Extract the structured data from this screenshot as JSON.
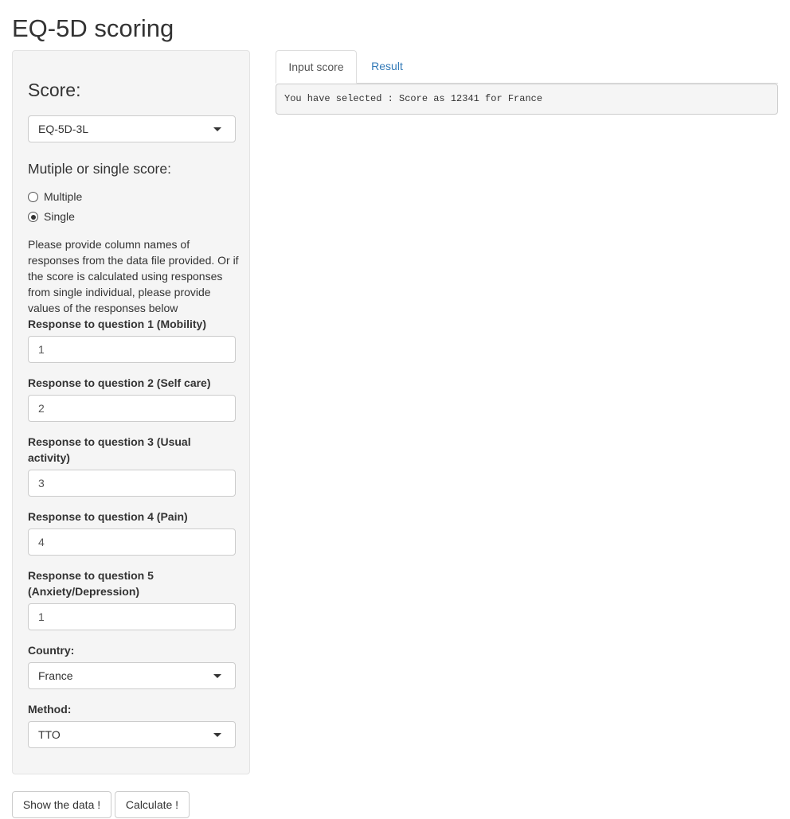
{
  "page": {
    "title": "EQ-5D scoring"
  },
  "sidebar": {
    "score_label": "Score:",
    "score_select_value": "EQ-5D-3L",
    "multiple_single_label": "Mutiple or single score:",
    "radio_multiple": "Multiple",
    "radio_single": "Single",
    "selected_mode": "Single",
    "help_text": "Please provide column names of responses from the data file provided. Or if the score is calculated using responses from single individual, please provide values of the responses below",
    "questions": [
      {
        "label": "Response to question 1 (Mobility)",
        "value": "1"
      },
      {
        "label": "Response to question 2 (Self care)",
        "value": "2"
      },
      {
        "label": "Response to question 3 (Usual activity)",
        "value": "3"
      },
      {
        "label": "Response to question 4 (Pain)",
        "value": "4"
      },
      {
        "label": "Response to question 5 (Anxiety/Depression)",
        "value": "1"
      }
    ],
    "country_label": "Country:",
    "country_value": "France",
    "method_label": "Method:",
    "method_value": "TTO"
  },
  "buttons": {
    "show_data": "Show the data !",
    "calculate": "Calculate !"
  },
  "tabs": [
    {
      "label": "Input score",
      "active": true
    },
    {
      "label": "Result",
      "active": false
    }
  ],
  "output": {
    "text": "You have selected : Score as 12341 for France"
  },
  "colors": {
    "link": "#337ab7",
    "well_background": "#f5f5f5",
    "border": "#cccccc"
  }
}
